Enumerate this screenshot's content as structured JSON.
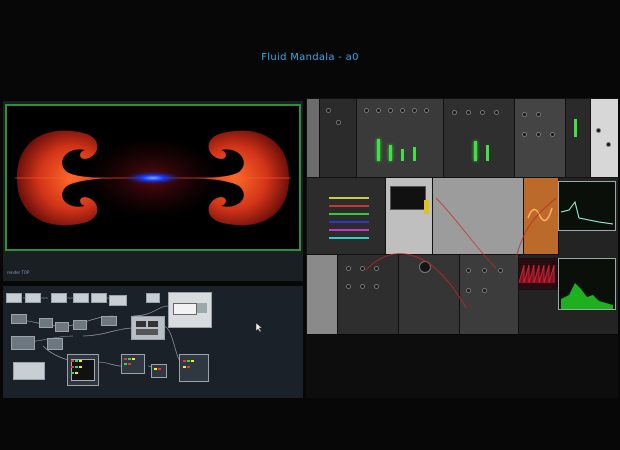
{
  "window": {
    "title": "Fluid Mandala - a0"
  },
  "render_panel": {
    "caption": "render TOP"
  },
  "colors": {
    "title": "#3aa7e8",
    "frame_border": "#2f8f3e",
    "fluid_outer": "#d23418",
    "fluid_core": "#1b3bff",
    "rack_bg": "#232323",
    "led_green": "#3fe33f",
    "scope_green": "#23d823",
    "wave_red": "#cc2233"
  },
  "icons": {
    "cursor": "mouse-pointer-icon"
  }
}
